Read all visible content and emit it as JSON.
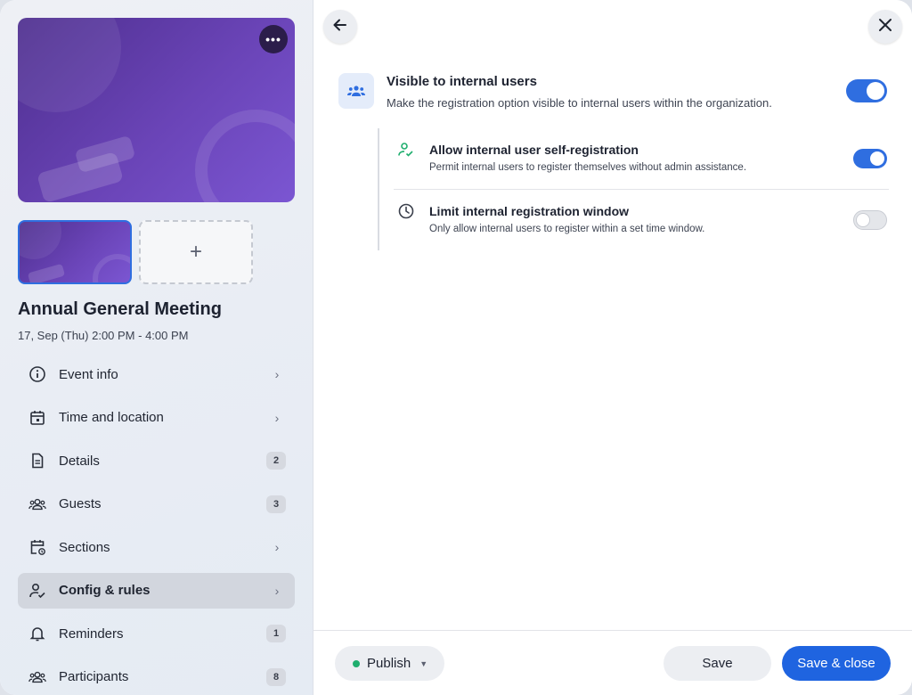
{
  "event": {
    "title": "Annual General Meeting",
    "date": "17, Sep (Thu) 2:00 PM - 4:00 PM",
    "cover_more_icon": "more-horizontal-icon",
    "add_image_icon": "plus-icon"
  },
  "nav": {
    "items": [
      {
        "label": "Event info",
        "icon": "info-icon",
        "trailing": "chevron"
      },
      {
        "label": "Time and location",
        "icon": "calendar-icon",
        "trailing": "chevron"
      },
      {
        "label": "Details",
        "icon": "document-icon",
        "badge": "2"
      },
      {
        "label": "Guests",
        "icon": "people-icon",
        "badge": "3"
      },
      {
        "label": "Sections",
        "icon": "calendar-sync-icon",
        "trailing": "chevron"
      },
      {
        "label": "Config & rules",
        "icon": "person-check-icon",
        "trailing": "chevron",
        "active": true
      },
      {
        "label": "Reminders",
        "icon": "bell-icon",
        "badge": "1"
      },
      {
        "label": "Participants",
        "icon": "people-icon",
        "badge": "8"
      }
    ]
  },
  "settings": {
    "main": {
      "title": "Visible to internal users",
      "description": "Make the registration option visible to internal users within the organization.",
      "enabled": true
    },
    "sub": [
      {
        "title": "Allow internal user self-registration",
        "description": "Permit internal users to register themselves without admin assistance.",
        "enabled": true
      },
      {
        "title": "Limit internal registration window",
        "description": "Only allow internal users to register within a set time window.",
        "enabled": false
      }
    ]
  },
  "footer": {
    "publish_label": "Publish",
    "save_label": "Save",
    "save_close_label": "Save & close"
  },
  "colors": {
    "accent": "#1f64e0",
    "status_dot": "#1fae6e",
    "cover": "#6a44b7"
  }
}
